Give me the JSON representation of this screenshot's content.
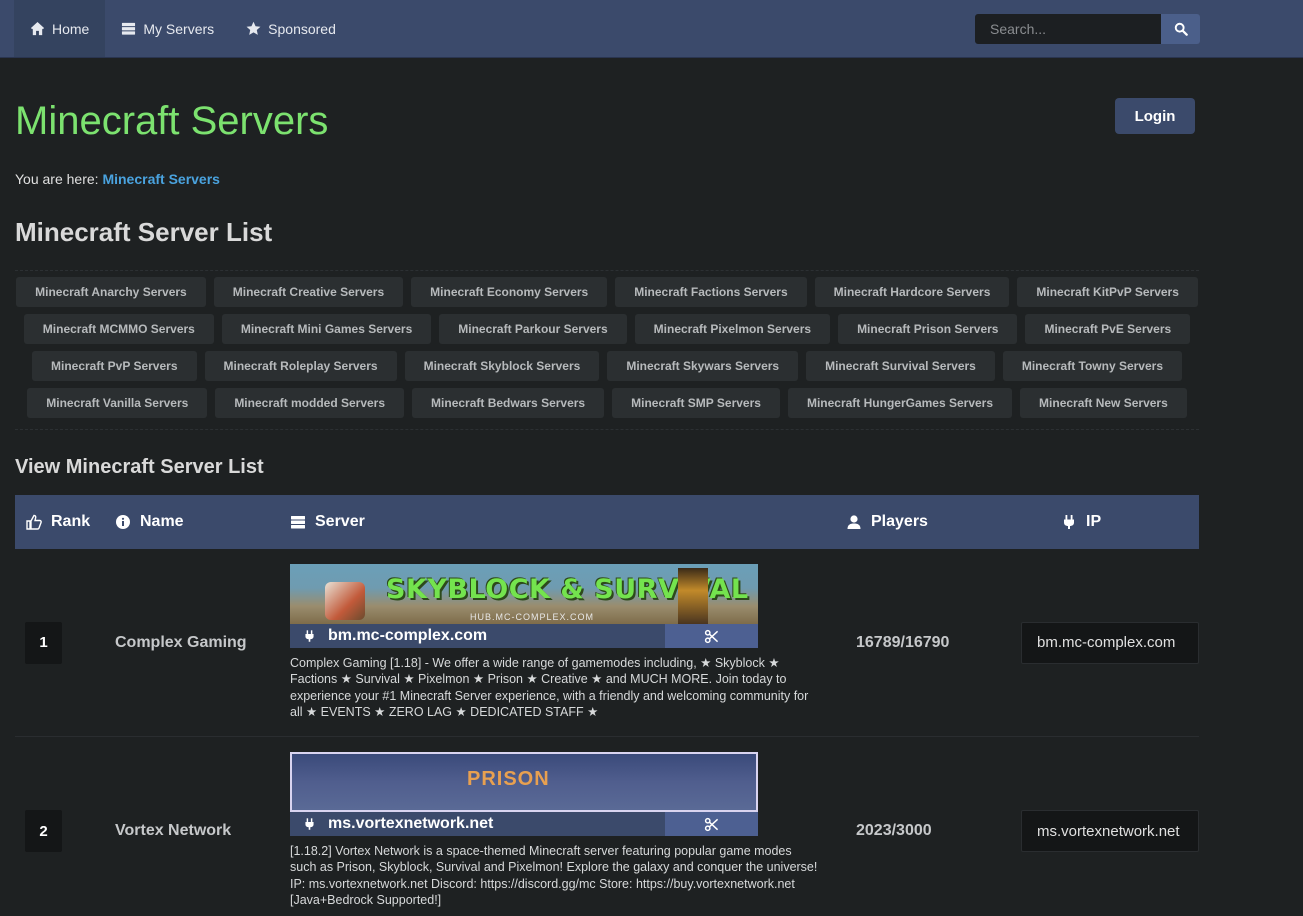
{
  "nav": {
    "items": [
      {
        "label": "Home",
        "icon": "home-icon"
      },
      {
        "label": "My Servers",
        "icon": "server-icon"
      },
      {
        "label": "Sponsored",
        "icon": "star-icon"
      }
    ],
    "search_placeholder": "Search..."
  },
  "header": {
    "title": "Minecraft Servers",
    "login_label": "Login",
    "breadcrumb_prefix": "You are here:",
    "breadcrumb_link": "Minecraft Servers"
  },
  "list_title": "Minecraft Server List",
  "tags": [
    [
      "Minecraft Anarchy Servers",
      "Minecraft Creative Servers",
      "Minecraft Economy Servers",
      "Minecraft Factions Servers",
      "Minecraft Hardcore Servers",
      "Minecraft KitPvP Servers"
    ],
    [
      "Minecraft MCMMO Servers",
      "Minecraft Mini Games Servers",
      "Minecraft Parkour Servers",
      "Minecraft Pixelmon Servers",
      "Minecraft Prison Servers",
      "Minecraft PvE Servers"
    ],
    [
      "Minecraft PvP Servers",
      "Minecraft Roleplay Servers",
      "Minecraft Skyblock Servers",
      "Minecraft Skywars Servers",
      "Minecraft Survival Servers",
      "Minecraft Towny Servers"
    ],
    [
      "Minecraft Vanilla Servers",
      "Minecraft modded Servers",
      "Minecraft Bedwars Servers",
      "Minecraft SMP Servers",
      "Minecraft HungerGames Servers",
      "Minecraft New Servers"
    ]
  ],
  "view_title": "View Minecraft Server List",
  "table": {
    "headers": {
      "rank": "Rank",
      "name": "Name",
      "server": "Server",
      "players": "Players",
      "ip": "IP"
    },
    "rows": [
      {
        "rank": "1",
        "name": "Complex Gaming",
        "banner_text": "SKYBLOCK & SURVIVAL",
        "banner_sub": "HUB.MC-COMPLEX.COM",
        "address": "bm.mc-complex.com",
        "description": "Complex Gaming [1.18] - We offer a wide range of gamemodes including, ★ Skyblock ★ Factions ★ Survival ★ Pixelmon ★ Prison ★ Creative ★ and MUCH MORE. Join today to experience your #1 Minecraft Server experience, with a friendly and welcoming community for all ★ EVENTS ★ ZERO LAG ★ DEDICATED STAFF ★",
        "players": "16789/16790",
        "ip": "bm.mc-complex.com"
      },
      {
        "rank": "2",
        "name": "Vortex Network",
        "banner_text": "PRISON",
        "address": "ms.vortexnetwork.net",
        "description": "[1.18.2] Vortex Network is a space-themed Minecraft server featuring popular game modes such as Prison, Skyblock, Survival and Pixelmon! Explore the galaxy and conquer the universe! IP: ms.vortexnetwork.net Discord: https://discord.gg/mc Store: https://buy.vortexnetwork.net [Java+Bedrock Supported!]",
        "players": "2023/3000",
        "ip": "ms.vortexnetwork.net"
      }
    ]
  }
}
